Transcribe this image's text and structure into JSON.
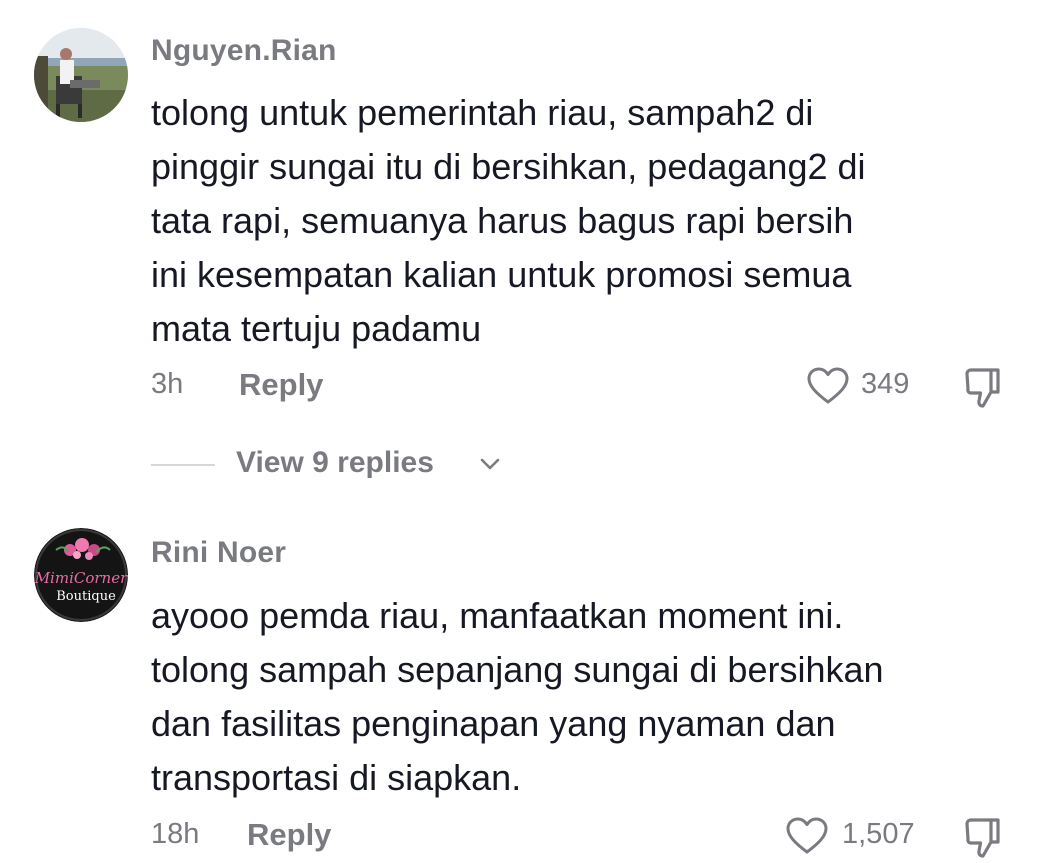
{
  "comments": [
    {
      "username": "Nguyen.Rian",
      "lines": [
        "tolong untuk pemerintah riau, sampah2 di",
        "pinggir sungai itu di bersihkan, pedagang2 di",
        "tata rapi, semuanya harus bagus rapi bersih",
        "ini kesempatan kalian untuk promosi semua",
        "mata tertuju padamu"
      ],
      "time": "3h",
      "reply_label": "Reply",
      "likes": "349",
      "view_replies": "View 9 replies"
    },
    {
      "username": "Rini Noer",
      "avatar_text": {
        "script": "MimiCorner",
        "word": "Boutique"
      },
      "lines": [
        "ayooo pemda riau, manfaatkan moment ini.",
        "tolong sampah sepanjang sungai di bersihkan",
        "dan fasilitas penginapan yang nyaman dan",
        "transportasi di siapkan."
      ],
      "time": "18h",
      "reply_label": "Reply",
      "likes": "1,507"
    }
  ],
  "colors": {
    "text": "#161823",
    "secondary": "#7a7b80",
    "divider": "#d6d7da"
  },
  "icons": {
    "like": "heart-outline-icon",
    "dislike": "thumbs-down-outline-icon",
    "expand": "chevron-down-icon"
  }
}
